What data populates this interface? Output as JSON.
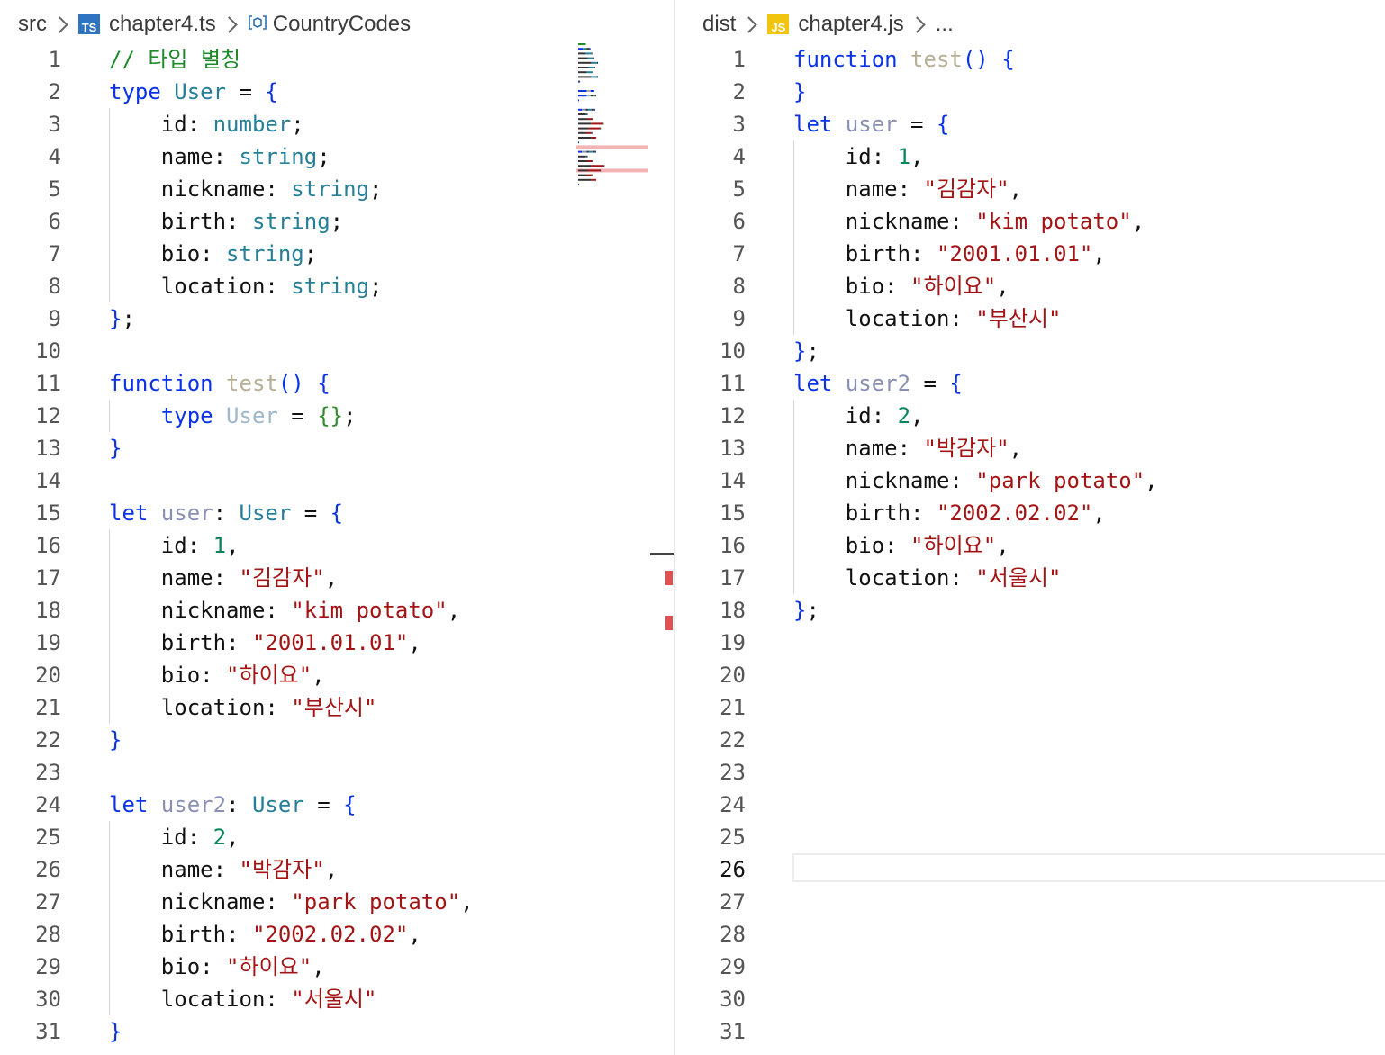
{
  "left_editor": {
    "breadcrumb": {
      "folder": "src",
      "file": "chapter4.ts",
      "file_icon": "TS",
      "symbol": "CountryCodes"
    },
    "lines": [
      {
        "n": "1",
        "tokens": [
          [
            "cmt",
            "// 타입 별칭"
          ]
        ]
      },
      {
        "n": "2",
        "tokens": [
          [
            "kw",
            "type "
          ],
          [
            "tname",
            "User"
          ],
          [
            "punc",
            " = "
          ],
          [
            "brace",
            "{"
          ]
        ]
      },
      {
        "n": "3",
        "tokens": [
          [
            "prop",
            "    id: "
          ],
          [
            "tname",
            "number"
          ],
          [
            "punc",
            ";"
          ]
        ]
      },
      {
        "n": "4",
        "tokens": [
          [
            "prop",
            "    name: "
          ],
          [
            "tname",
            "string"
          ],
          [
            "punc",
            ";"
          ]
        ]
      },
      {
        "n": "5",
        "tokens": [
          [
            "prop",
            "    nickname: "
          ],
          [
            "tname",
            "string"
          ],
          [
            "punc",
            ";"
          ]
        ]
      },
      {
        "n": "6",
        "tokens": [
          [
            "prop",
            "    birth: "
          ],
          [
            "tname",
            "string"
          ],
          [
            "punc",
            ";"
          ]
        ]
      },
      {
        "n": "7",
        "tokens": [
          [
            "prop",
            "    bio: "
          ],
          [
            "tname",
            "string"
          ],
          [
            "punc",
            ";"
          ]
        ]
      },
      {
        "n": "8",
        "tokens": [
          [
            "prop",
            "    location: "
          ],
          [
            "tname",
            "string"
          ],
          [
            "punc",
            ";"
          ]
        ]
      },
      {
        "n": "9",
        "tokens": [
          [
            "brace",
            "}"
          ],
          [
            "punc",
            ";"
          ]
        ]
      },
      {
        "n": "10",
        "tokens": []
      },
      {
        "n": "11",
        "tokens": [
          [
            "kw",
            "function "
          ],
          [
            "fn",
            "test"
          ],
          [
            "brace",
            "() {"
          ]
        ]
      },
      {
        "n": "12",
        "tokens": [
          [
            "kw",
            "    type "
          ],
          [
            "faded",
            "User"
          ],
          [
            "punc",
            " = "
          ],
          [
            "brace2",
            "{}"
          ],
          [
            "punc",
            ";"
          ]
        ]
      },
      {
        "n": "13",
        "tokens": [
          [
            "brace",
            "}"
          ]
        ]
      },
      {
        "n": "14",
        "tokens": []
      },
      {
        "n": "15",
        "tokens": [
          [
            "kw",
            "let "
          ],
          [
            "var",
            "user"
          ],
          [
            "punc",
            ": "
          ],
          [
            "tname",
            "User"
          ],
          [
            "punc",
            " = "
          ],
          [
            "brace",
            "{"
          ]
        ]
      },
      {
        "n": "16",
        "tokens": [
          [
            "prop",
            "    id: "
          ],
          [
            "num",
            "1"
          ],
          [
            "punc",
            ","
          ]
        ]
      },
      {
        "n": "17",
        "tokens": [
          [
            "prop",
            "    name: "
          ],
          [
            "str",
            "\"김감자\""
          ],
          [
            "punc",
            ","
          ]
        ]
      },
      {
        "n": "18",
        "tokens": [
          [
            "prop",
            "    nickname: "
          ],
          [
            "str",
            "\"kim potato\""
          ],
          [
            "punc",
            ","
          ]
        ]
      },
      {
        "n": "19",
        "tokens": [
          [
            "prop",
            "    birth: "
          ],
          [
            "str",
            "\"2001.01.01\""
          ],
          [
            "punc",
            ","
          ]
        ]
      },
      {
        "n": "20",
        "tokens": [
          [
            "prop",
            "    bio: "
          ],
          [
            "str",
            "\"하이요\""
          ],
          [
            "punc",
            ","
          ]
        ]
      },
      {
        "n": "21",
        "tokens": [
          [
            "prop",
            "    location: "
          ],
          [
            "str",
            "\"부산시\""
          ]
        ]
      },
      {
        "n": "22",
        "tokens": [
          [
            "brace",
            "}"
          ]
        ]
      },
      {
        "n": "23",
        "tokens": []
      },
      {
        "n": "24",
        "tokens": [
          [
            "kw",
            "let "
          ],
          [
            "var",
            "user2"
          ],
          [
            "punc",
            ": "
          ],
          [
            "tname",
            "User"
          ],
          [
            "punc",
            " = "
          ],
          [
            "brace",
            "{"
          ]
        ]
      },
      {
        "n": "25",
        "tokens": [
          [
            "prop",
            "    id: "
          ],
          [
            "num",
            "2"
          ],
          [
            "punc",
            ","
          ]
        ]
      },
      {
        "n": "26",
        "tokens": [
          [
            "prop",
            "    name: "
          ],
          [
            "str",
            "\"박감자\""
          ],
          [
            "punc",
            ","
          ]
        ]
      },
      {
        "n": "27",
        "tokens": [
          [
            "prop",
            "    nickname: "
          ],
          [
            "str",
            "\"park potato\""
          ],
          [
            "punc",
            ","
          ]
        ]
      },
      {
        "n": "28",
        "tokens": [
          [
            "prop",
            "    birth: "
          ],
          [
            "str",
            "\"2002.02.02\""
          ],
          [
            "punc",
            ","
          ]
        ]
      },
      {
        "n": "29",
        "tokens": [
          [
            "prop",
            "    bio: "
          ],
          [
            "str",
            "\"하이요\""
          ],
          [
            "punc",
            ","
          ]
        ]
      },
      {
        "n": "30",
        "tokens": [
          [
            "prop",
            "    location: "
          ],
          [
            "str",
            "\"서울시\""
          ]
        ]
      },
      {
        "n": "31",
        "tokens": [
          [
            "brace",
            "}"
          ]
        ]
      }
    ]
  },
  "right_editor": {
    "breadcrumb": {
      "folder": "dist",
      "file": "chapter4.js",
      "file_icon": "JS",
      "more": "..."
    },
    "current_line": "26",
    "lines": [
      {
        "n": "1",
        "tokens": [
          [
            "kw",
            "function "
          ],
          [
            "fn",
            "test"
          ],
          [
            "brace",
            "() {"
          ]
        ]
      },
      {
        "n": "2",
        "tokens": [
          [
            "brace",
            "}"
          ]
        ]
      },
      {
        "n": "3",
        "tokens": [
          [
            "kw",
            "let "
          ],
          [
            "var",
            "user"
          ],
          [
            "punc",
            " = "
          ],
          [
            "brace",
            "{"
          ]
        ]
      },
      {
        "n": "4",
        "tokens": [
          [
            "prop",
            "    id: "
          ],
          [
            "num",
            "1"
          ],
          [
            "punc",
            ","
          ]
        ]
      },
      {
        "n": "5",
        "tokens": [
          [
            "prop",
            "    name: "
          ],
          [
            "str",
            "\"김감자\""
          ],
          [
            "punc",
            ","
          ]
        ]
      },
      {
        "n": "6",
        "tokens": [
          [
            "prop",
            "    nickname: "
          ],
          [
            "str",
            "\"kim potato\""
          ],
          [
            "punc",
            ","
          ]
        ]
      },
      {
        "n": "7",
        "tokens": [
          [
            "prop",
            "    birth: "
          ],
          [
            "str",
            "\"2001.01.01\""
          ],
          [
            "punc",
            ","
          ]
        ]
      },
      {
        "n": "8",
        "tokens": [
          [
            "prop",
            "    bio: "
          ],
          [
            "str",
            "\"하이요\""
          ],
          [
            "punc",
            ","
          ]
        ]
      },
      {
        "n": "9",
        "tokens": [
          [
            "prop",
            "    location: "
          ],
          [
            "str",
            "\"부산시\""
          ]
        ]
      },
      {
        "n": "10",
        "tokens": [
          [
            "brace",
            "}"
          ],
          [
            "punc",
            ";"
          ]
        ]
      },
      {
        "n": "11",
        "tokens": [
          [
            "kw",
            "let "
          ],
          [
            "var",
            "user2"
          ],
          [
            "punc",
            " = "
          ],
          [
            "brace",
            "{"
          ]
        ]
      },
      {
        "n": "12",
        "tokens": [
          [
            "prop",
            "    id: "
          ],
          [
            "num",
            "2"
          ],
          [
            "punc",
            ","
          ]
        ]
      },
      {
        "n": "13",
        "tokens": [
          [
            "prop",
            "    name: "
          ],
          [
            "str",
            "\"박감자\""
          ],
          [
            "punc",
            ","
          ]
        ]
      },
      {
        "n": "14",
        "tokens": [
          [
            "prop",
            "    nickname: "
          ],
          [
            "str",
            "\"park potato\""
          ],
          [
            "punc",
            ","
          ]
        ]
      },
      {
        "n": "15",
        "tokens": [
          [
            "prop",
            "    birth: "
          ],
          [
            "str",
            "\"2002.02.02\""
          ],
          [
            "punc",
            ","
          ]
        ]
      },
      {
        "n": "16",
        "tokens": [
          [
            "prop",
            "    bio: "
          ],
          [
            "str",
            "\"하이요\""
          ],
          [
            "punc",
            ","
          ]
        ]
      },
      {
        "n": "17",
        "tokens": [
          [
            "prop",
            "    location: "
          ],
          [
            "str",
            "\"서울시\""
          ]
        ]
      },
      {
        "n": "18",
        "tokens": [
          [
            "brace",
            "}"
          ],
          [
            "punc",
            ";"
          ]
        ]
      },
      {
        "n": "19",
        "tokens": []
      },
      {
        "n": "20",
        "tokens": []
      },
      {
        "n": "21",
        "tokens": []
      },
      {
        "n": "22",
        "tokens": []
      },
      {
        "n": "23",
        "tokens": []
      },
      {
        "n": "24",
        "tokens": []
      },
      {
        "n": "25",
        "tokens": []
      },
      {
        "n": "26",
        "tokens": []
      },
      {
        "n": "27",
        "tokens": []
      },
      {
        "n": "28",
        "tokens": []
      },
      {
        "n": "29",
        "tokens": []
      },
      {
        "n": "30",
        "tokens": []
      },
      {
        "n": "31",
        "tokens": []
      }
    ]
  }
}
